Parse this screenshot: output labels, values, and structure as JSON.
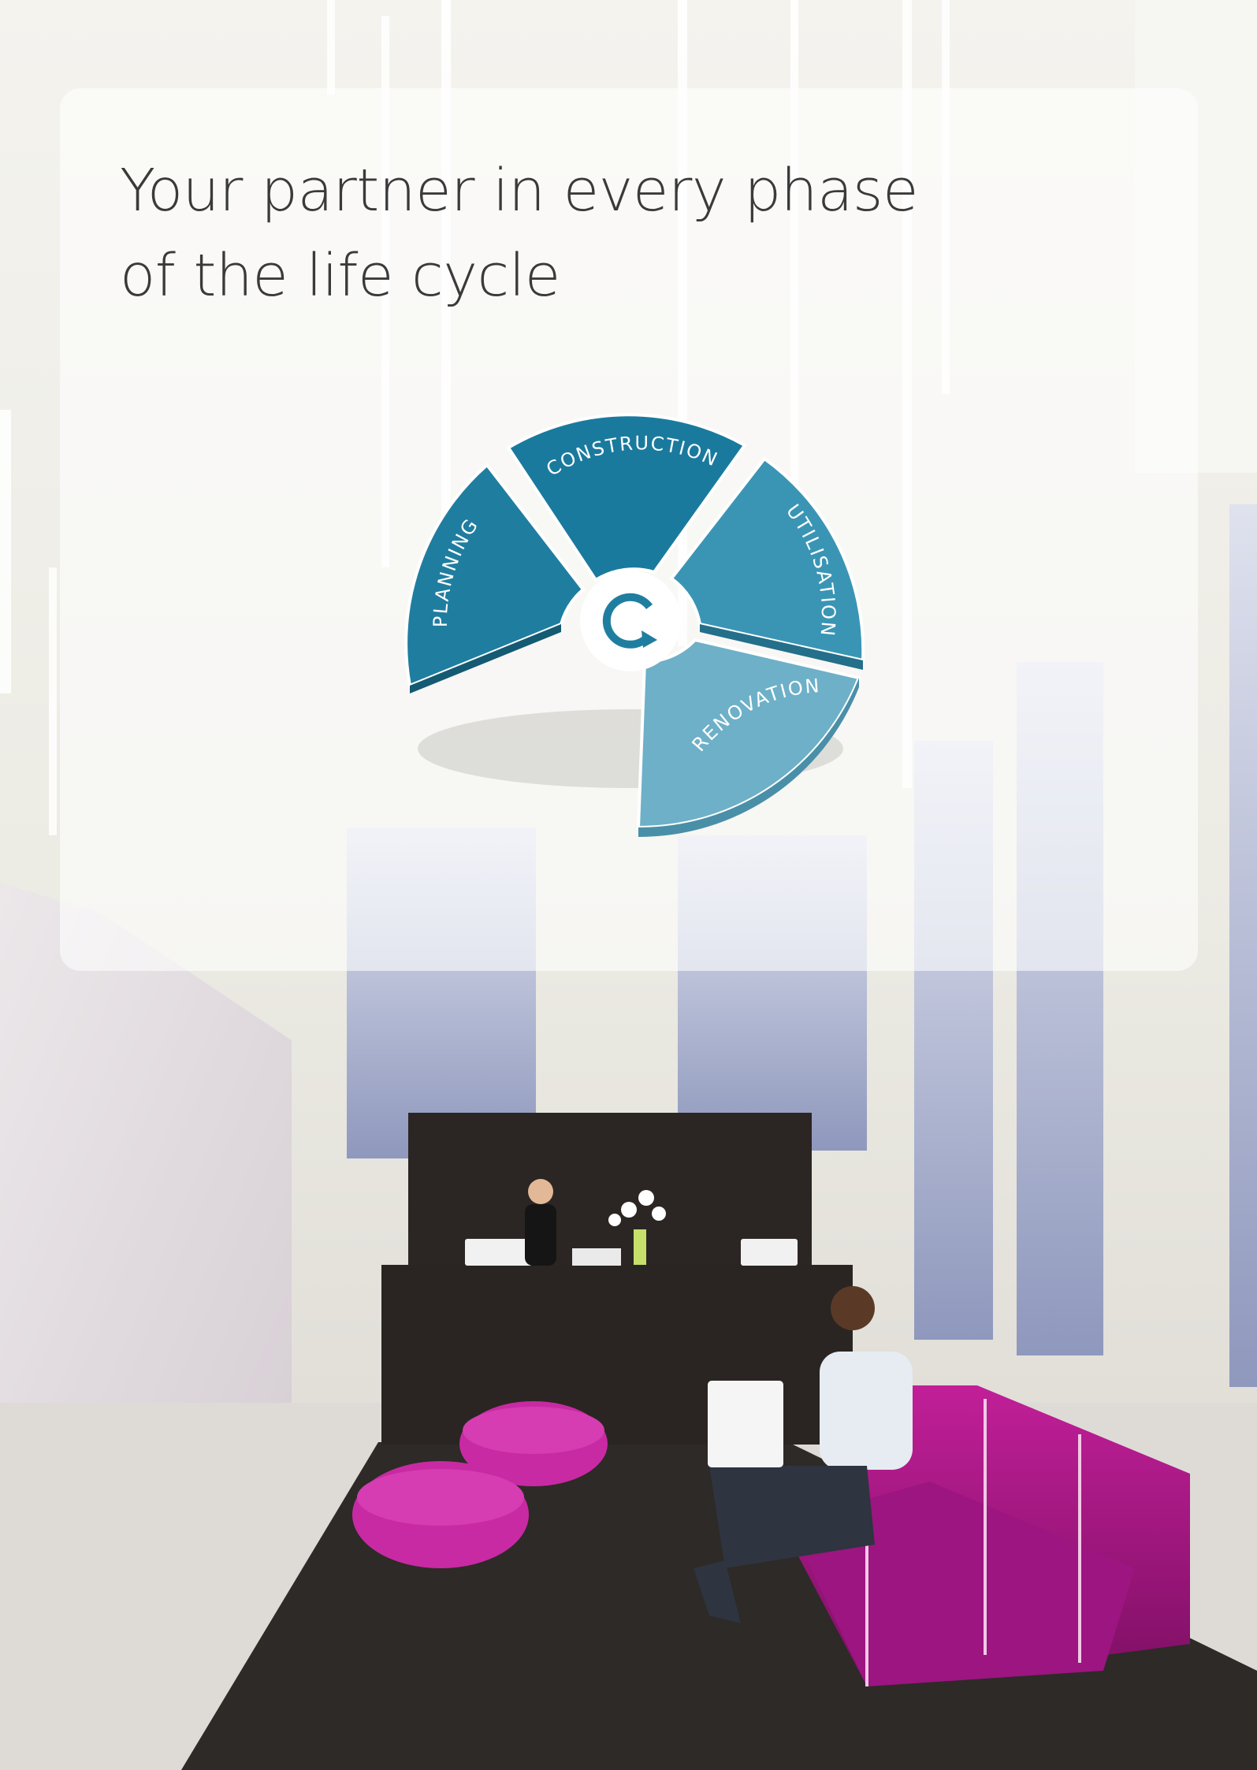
{
  "headline": {
    "line1": "Your partner in every phase",
    "line2": "of the life cycle"
  },
  "life_cycle": {
    "phases": [
      {
        "label": "PLANNING",
        "color": "#1f7ea0"
      },
      {
        "label": "CONSTRUCTION",
        "color": "#1a7a9e"
      },
      {
        "label": "UTILISATION",
        "color": "#3a95b5"
      },
      {
        "label": "RENOVATION",
        "color": "#6db0c8"
      }
    ],
    "center_icon": "cycle-arrow-icon"
  },
  "colors": {
    "panel": "#ffffff",
    "sofa": "#b0188a",
    "floor": "#2d2a27",
    "desk": "#2a2522"
  }
}
